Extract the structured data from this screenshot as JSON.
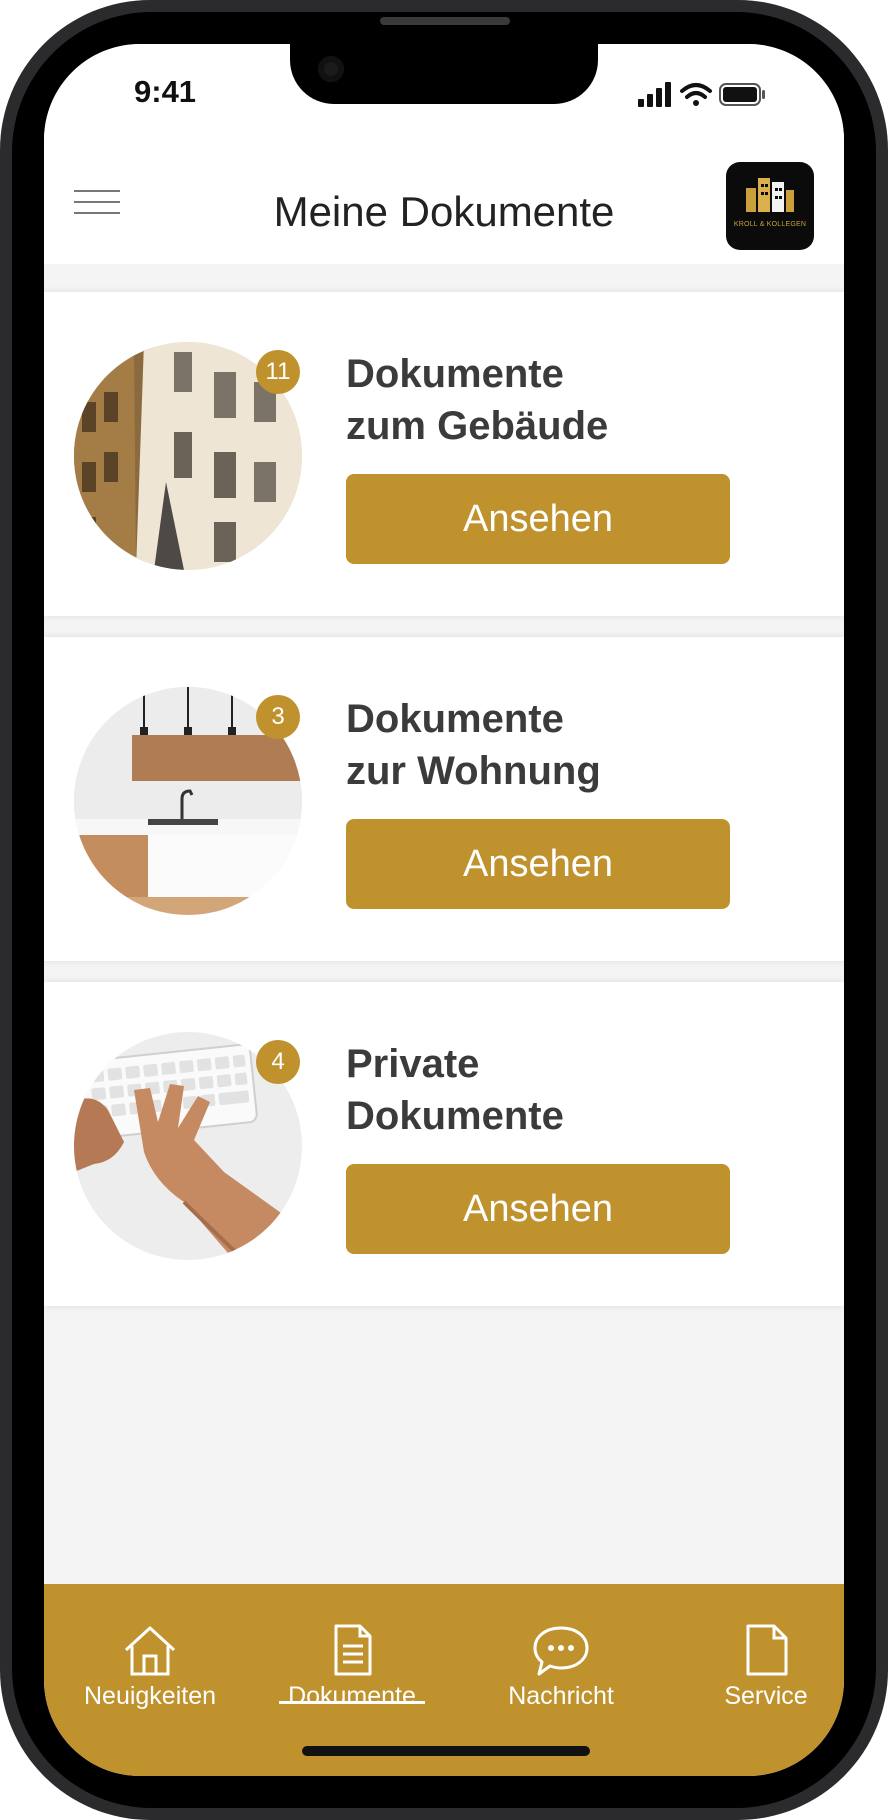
{
  "status_bar": {
    "time": "9:41",
    "icons": [
      "cellular-signal-icon",
      "wifi-icon",
      "battery-icon"
    ]
  },
  "header": {
    "menu_icon": "hamburger-menu-icon",
    "title": "Meine Dokumente",
    "logo_text": "KROLL & KOLLEGEN"
  },
  "cards": [
    {
      "title_line1": "Dokumente",
      "title_line2": "zum Gebäude",
      "badge": "11",
      "button": "Ansehen",
      "image": "building-facade-photo"
    },
    {
      "title_line1": "Dokumente",
      "title_line2": "zur Wohnung",
      "badge": "3",
      "button": "Ansehen",
      "image": "kitchen-photo"
    },
    {
      "title_line1": "Private",
      "title_line2": "Dokumente",
      "badge": "4",
      "button": "Ansehen",
      "image": "keyboard-hands-photo"
    }
  ],
  "tab_bar": {
    "active": "Dokumente",
    "items": [
      {
        "label": "Neuigkeiten",
        "icon": "home-icon"
      },
      {
        "label": "Dokumente",
        "icon": "document-icon"
      },
      {
        "label": "Nachricht",
        "icon": "chat-bubble-icon"
      },
      {
        "label": "Service",
        "icon": "file-icon"
      }
    ]
  },
  "colors": {
    "accent": "#c0922e",
    "background": "#f4f4f4",
    "text": "#3b3b3b"
  }
}
